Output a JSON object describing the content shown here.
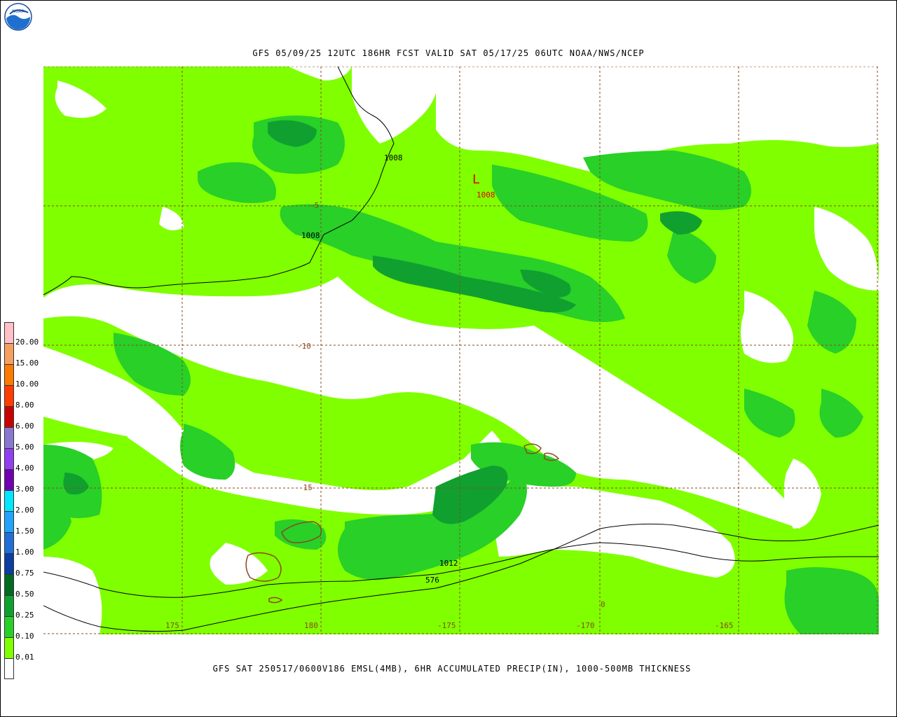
{
  "title": "GFS 05/09/25 12UTC 186HR FCST VALID SAT 05/17/25 06UTC NOAA/NWS/NCEP",
  "footer": "GFS SAT 250517/0600V186 EMSL(4MB), 6HR ACCUMULATED PRECIP(IN), 1000-500MB THICKNESS",
  "logo_text": "NOAA",
  "legend": {
    "labels": [
      "20.00",
      "15.00",
      "10.00",
      "8.00",
      "6.00",
      "5.00",
      "4.00",
      "3.00",
      "2.00",
      "1.50",
      "1.00",
      "0.75",
      "0.50",
      "0.25",
      "0.10",
      "0.01"
    ],
    "colors": [
      "#ffc0c8",
      "#f5a060",
      "#ff7a00",
      "#ff3d00",
      "#c80000",
      "#8a78d0",
      "#9040f0",
      "#7000b0",
      "#00e6ff",
      "#21a4ff",
      "#1e70d8",
      "#0c3da0",
      "#006a20",
      "#10a030",
      "#28d028",
      "#80ff00",
      "#ffffff"
    ]
  },
  "lat_labels": [
    "-5",
    "-10",
    "-15"
  ],
  "lon_labels": [
    "175",
    "180",
    "-175",
    "-170",
    "-165"
  ],
  "isobars": [
    "1008",
    "1008",
    "1012",
    "576"
  ],
  "low": {
    "symbol": "L",
    "value": "1008"
  },
  "stray_label": "0"
}
